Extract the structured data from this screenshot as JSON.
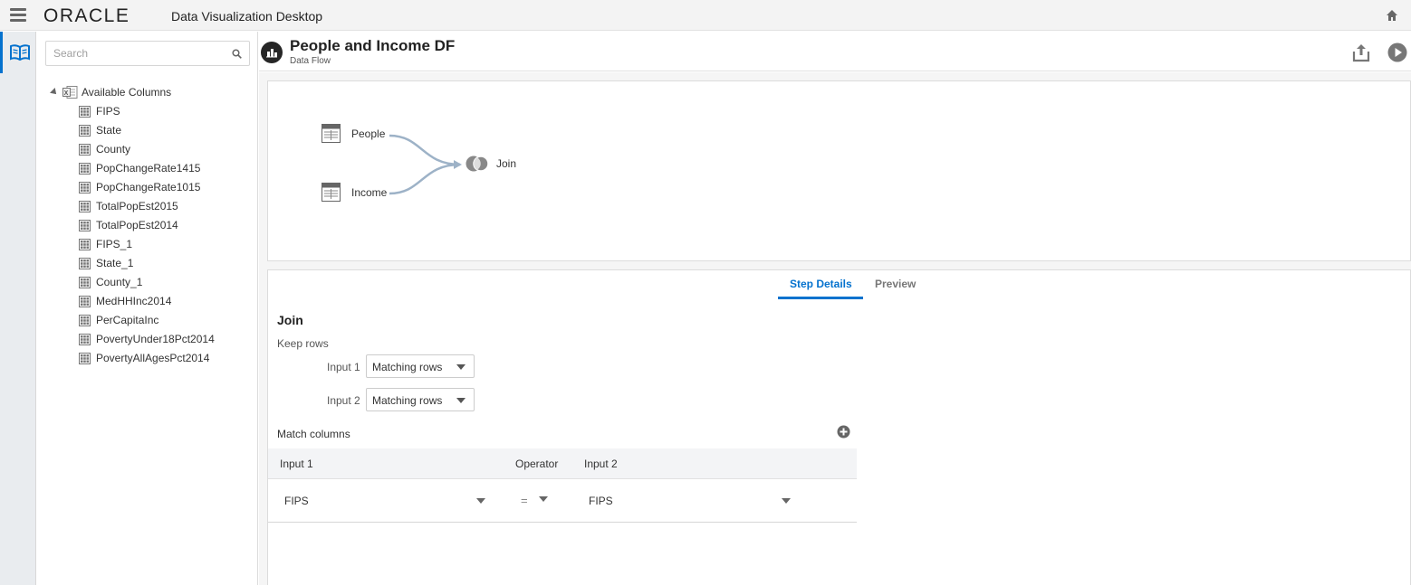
{
  "app": {
    "brand": "ORACLE",
    "title": "Data Visualization Desktop"
  },
  "search": {
    "placeholder": "Search",
    "value": ""
  },
  "tree": {
    "root_label": "Available Columns",
    "columns": [
      "FIPS",
      "State",
      "County",
      "PopChangeRate1415",
      "PopChangeRate1015",
      "TotalPopEst2015",
      "TotalPopEst2014",
      "FIPS_1",
      "State_1",
      "County_1",
      "MedHHInc2014",
      "PerCapitaInc",
      "PovertyUnder18Pct2014",
      "PovertyAllAgesPct2014"
    ]
  },
  "dataflow": {
    "title": "People and Income DF",
    "subtitle": "Data Flow"
  },
  "flow": {
    "nodes": {
      "people": "People",
      "income": "Income",
      "join": "Join"
    }
  },
  "tabs": {
    "step_details": "Step Details",
    "preview": "Preview"
  },
  "step": {
    "title": "Join",
    "keep_rows_label": "Keep rows",
    "input1_label": "Input 1",
    "input1_value": "Matching rows",
    "input2_label": "Input 2",
    "input2_value": "Matching rows",
    "match_columns_label": "Match columns"
  },
  "match_table": {
    "headers": {
      "input1": "Input 1",
      "operator": "Operator",
      "input2": "Input 2"
    },
    "rows": [
      {
        "input1": "FIPS",
        "operator": "=",
        "input2": "FIPS"
      }
    ]
  },
  "colors": {
    "accent": "#0572ce",
    "flow_line": "#9db2c7"
  }
}
